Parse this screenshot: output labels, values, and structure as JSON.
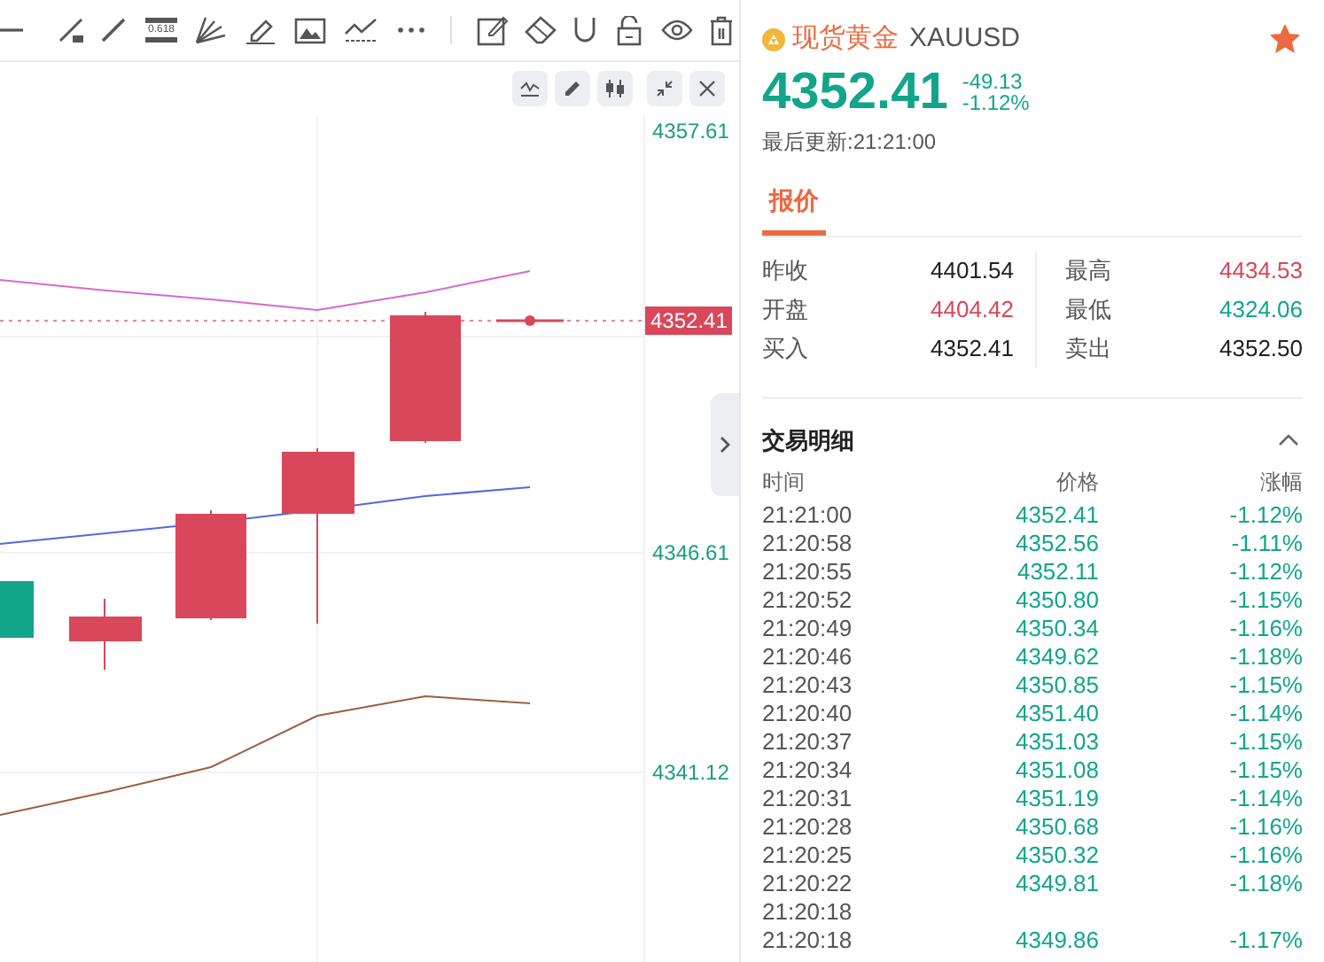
{
  "toolbar": {
    "fib_label": "0.618"
  },
  "chart": {
    "axis_labels": [
      "4357.61",
      "4346.61",
      "4341.12"
    ],
    "last_price": "4352.41"
  },
  "quote": {
    "name": "现货黄金",
    "symbol": "XAUUSD",
    "favorite": true,
    "price": "4352.41",
    "change": "-49.13",
    "change_pct": "-1.12%",
    "updated": "最后更新:21:21:00"
  },
  "tabs": [
    {
      "label": "报价",
      "selected": true
    }
  ],
  "stats": [
    {
      "label": "昨收",
      "value": "4401.54",
      "color": "#222222"
    },
    {
      "label": "最高",
      "value": "4434.53",
      "color": "#d9475a"
    },
    {
      "label": "开盘",
      "value": "4404.42",
      "color": "#d9475a"
    },
    {
      "label": "最低",
      "value": "4324.06",
      "color": "#13a58a"
    },
    {
      "label": "买入",
      "value": "4352.41",
      "color": "#222222"
    },
    {
      "label": "卖出",
      "value": "4352.50",
      "color": "#222222"
    }
  ],
  "trades": {
    "title": "交易明细",
    "expanded": true,
    "columns": [
      "时间",
      "价格",
      "涨幅"
    ],
    "rows": [
      {
        "time": "21:21:00",
        "price": "4352.41",
        "change": "-1.12%"
      },
      {
        "time": "21:20:58",
        "price": "4352.56",
        "change": "-1.11%"
      },
      {
        "time": "21:20:55",
        "price": "4352.11",
        "change": "-1.12%"
      },
      {
        "time": "21:20:52",
        "price": "4350.80",
        "change": "-1.15%"
      },
      {
        "time": "21:20:49",
        "price": "4350.34",
        "change": "-1.16%"
      },
      {
        "time": "21:20:46",
        "price": "4349.62",
        "change": "-1.18%"
      },
      {
        "time": "21:20:43",
        "price": "4350.85",
        "change": "-1.15%"
      },
      {
        "time": "21:20:40",
        "price": "4351.40",
        "change": "-1.14%"
      },
      {
        "time": "21:20:37",
        "price": "4351.03",
        "change": "-1.15%"
      },
      {
        "time": "21:20:34",
        "price": "4351.08",
        "change": "-1.15%"
      },
      {
        "time": "21:20:31",
        "price": "4351.19",
        "change": "-1.14%"
      },
      {
        "time": "21:20:28",
        "price": "4350.68",
        "change": "-1.16%"
      },
      {
        "time": "21:20:25",
        "price": "4350.32",
        "change": "-1.16%"
      },
      {
        "time": "21:20:22",
        "price": "4349.81",
        "change": "-1.18%"
      },
      {
        "time": "21:20:18"
      },
      {
        "time": "21:20:18",
        "price": "4349.86",
        "change": "-1.17%"
      }
    ]
  }
}
